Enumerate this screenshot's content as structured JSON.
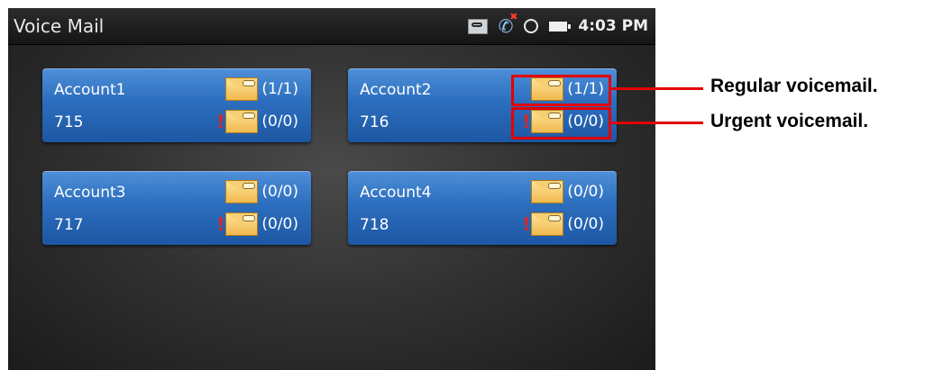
{
  "status_bar": {
    "title": "Voice Mail",
    "time": "4:03 PM",
    "icons": [
      "voicemail-icon",
      "missed-call-icon",
      "sync-icon",
      "battery-icon"
    ]
  },
  "accounts": [
    {
      "name": "Account1",
      "number": "715",
      "regular": "(1/1)",
      "urgent": "(0/0)"
    },
    {
      "name": "Account2",
      "number": "716",
      "regular": "(1/1)",
      "urgent": "(0/0)"
    },
    {
      "name": "Account3",
      "number": "717",
      "regular": "(0/0)",
      "urgent": "(0/0)"
    },
    {
      "name": "Account4",
      "number": "718",
      "regular": "(0/0)",
      "urgent": "(0/0)"
    }
  ],
  "annotations": {
    "regular": "Regular voicemail.",
    "urgent": "Urgent voicemail."
  },
  "colors": {
    "card_blue": "#2c6ebe",
    "urgent_red": "#e0232a",
    "callout_red": "#e30000"
  }
}
